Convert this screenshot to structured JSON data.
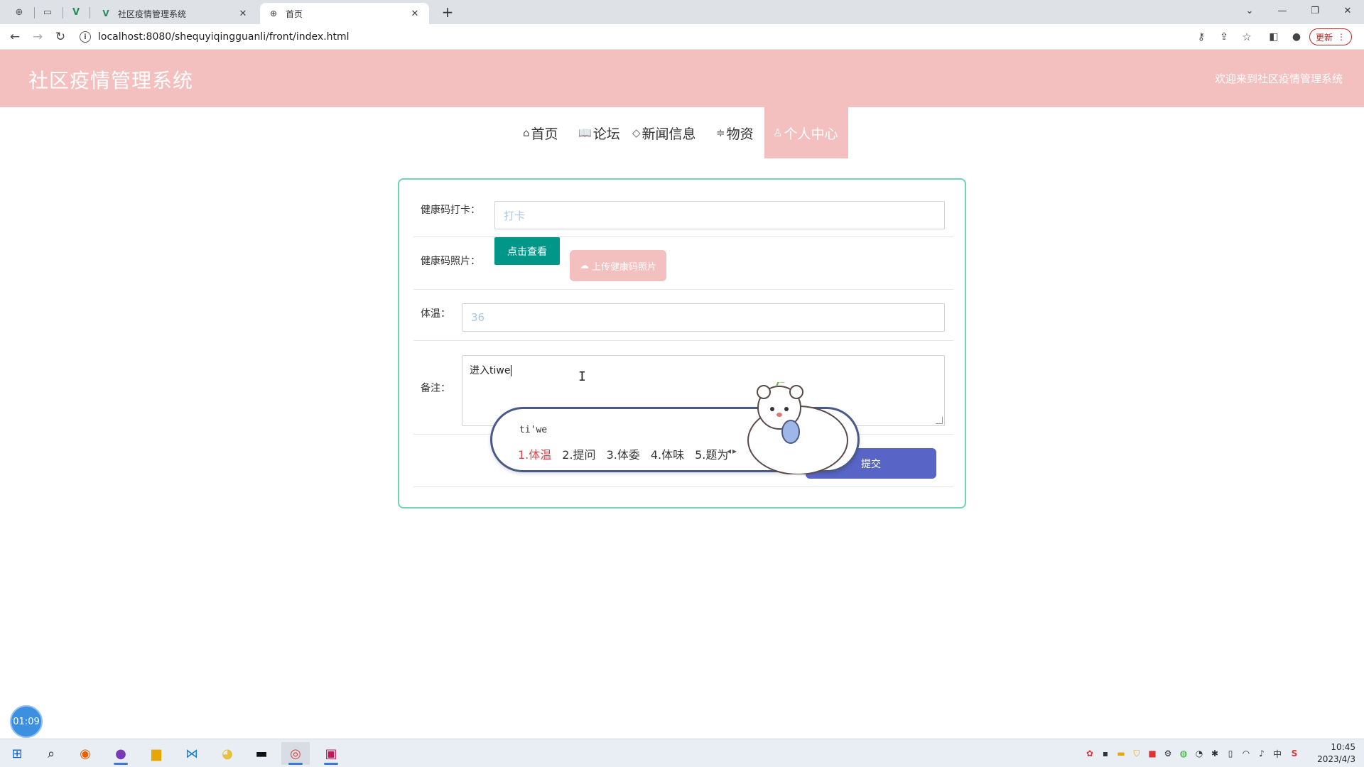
{
  "browser": {
    "tabs": [
      {
        "title": "社区疫情管理系统",
        "active": false
      },
      {
        "title": "首页",
        "active": true
      }
    ],
    "url": "localhost:8080/shequyiqingguanli/front/index.html",
    "update_label": "更新"
  },
  "header": {
    "title": "社区疫情管理系统",
    "welcome": "欢迎来到社区疫情管理系统"
  },
  "nav": {
    "items": [
      {
        "icon": "home-icon",
        "label": "首页"
      },
      {
        "icon": "book-icon",
        "label": "论坛"
      },
      {
        "icon": "tag-icon",
        "label": "新闻信息"
      },
      {
        "icon": "sliders-icon",
        "label": "物资"
      },
      {
        "icon": "user-icon",
        "label": "个人中心",
        "active": true
      }
    ]
  },
  "form": {
    "checkin_label": "健康码打卡：",
    "checkin_placeholder": "打卡",
    "photo_label": "健康码照片：",
    "view_button": "点击查看",
    "upload_button": "上传健康码照片",
    "temp_label": "体温：",
    "temp_placeholder": "36",
    "note_label": "备注：",
    "note_value": "进入tiwe",
    "submit_button": "提交"
  },
  "ime": {
    "composition": "ti'we",
    "candidates": [
      "1.体温",
      "2.提问",
      "3.体委",
      "4.体味",
      "5.题为"
    ]
  },
  "timer": "01:09",
  "taskbar": {
    "time": "10:45",
    "date": "2023/4/3",
    "ime_lang": "中"
  },
  "colors": {
    "header_bg": "#f4bfbf",
    "card_border": "#6fd3b6",
    "view_btn": "#009688",
    "submit_btn": "#5865c6"
  }
}
